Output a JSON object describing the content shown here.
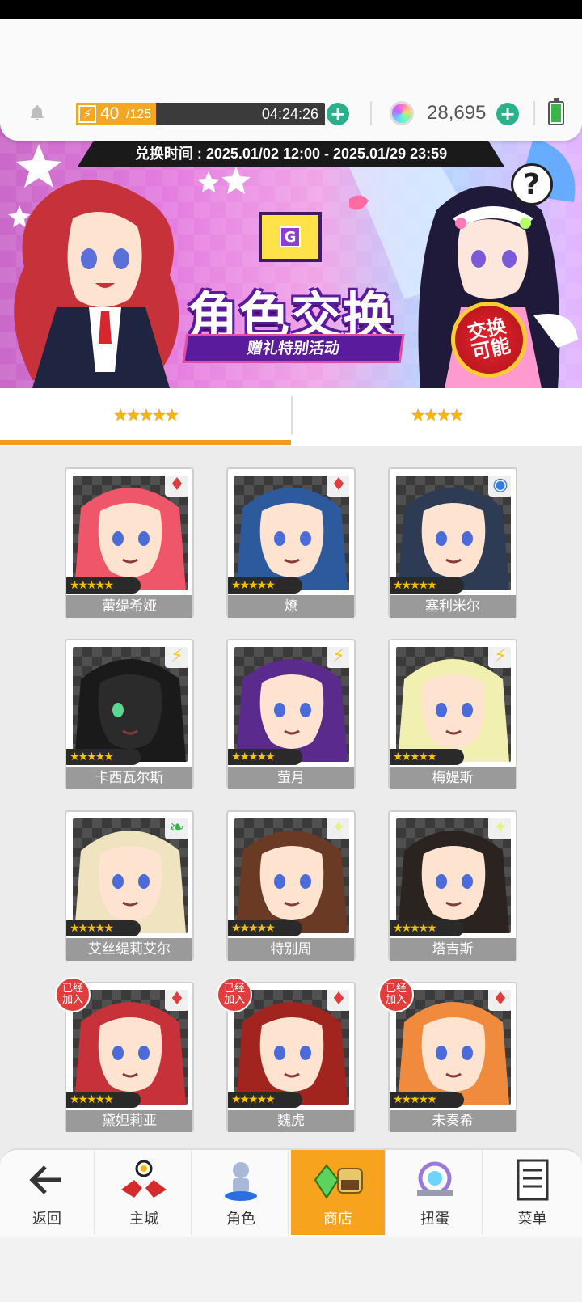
{
  "status_bar": {
    "stamina_current": "40",
    "stamina_max": "/125",
    "stamina_fraction": 0.32,
    "stamina_timer": "04:24:26",
    "gems": "28,695"
  },
  "banner": {
    "date_range": "兑换时间 : 2025.01/02 12:00 - 2025.01/29 23:59",
    "title": "角色交换",
    "subtitle": "赠礼特别活动",
    "badge_line1": "交换",
    "badge_line2": "可能",
    "help": "?",
    "envelope_letter": "G"
  },
  "tabs": [
    {
      "stars": "★★★★★",
      "selected": true
    },
    {
      "stars": "★★★★",
      "selected": false
    }
  ],
  "characters": [
    {
      "name": "蕾缇希娅",
      "stars": "★★★★★",
      "attr": "fire",
      "joined": false
    },
    {
      "name": "燎",
      "stars": "★★★★★",
      "attr": "fire",
      "joined": false
    },
    {
      "name": "塞利米尔",
      "stars": "★★★★★",
      "attr": "water",
      "joined": false
    },
    {
      "name": "卡西瓦尔斯",
      "stars": "★★★★★",
      "attr": "thunder",
      "joined": false
    },
    {
      "name": "萤月",
      "stars": "★★★★★",
      "attr": "thunder",
      "joined": false
    },
    {
      "name": "梅媞斯",
      "stars": "★★★★★",
      "attr": "thunder",
      "joined": false
    },
    {
      "name": "艾丝缇莉艾尔",
      "stars": "★★★★★",
      "attr": "wind",
      "joined": false
    },
    {
      "name": "特别周",
      "stars": "★★★★★",
      "attr": "light",
      "joined": false
    },
    {
      "name": "塔吉斯",
      "stars": "★★★★★",
      "attr": "light",
      "joined": false
    },
    {
      "name": "黛妲莉亚",
      "stars": "★★★★★",
      "attr": "fire",
      "joined": true
    },
    {
      "name": "魏虎",
      "stars": "★★★★★",
      "attr": "fire",
      "joined": true
    },
    {
      "name": "未奏希",
      "stars": "★★★★★",
      "attr": "fire",
      "joined": true
    }
  ],
  "joined_label_1": "已经",
  "joined_label_2": "加入",
  "nav": [
    {
      "label": "返回",
      "icon": "back-arrow-icon",
      "active": false
    },
    {
      "label": "主城",
      "icon": "castle-icon",
      "active": false
    },
    {
      "label": "角色",
      "icon": "character-icon",
      "active": false
    },
    {
      "label": "商店",
      "icon": "shop-icon",
      "active": true
    },
    {
      "label": "扭蛋",
      "icon": "gacha-icon",
      "active": false
    },
    {
      "label": "菜单",
      "icon": "menu-icon",
      "active": false
    }
  ],
  "colors": {
    "accent": "#f19a1b",
    "stamina": "#f5a623",
    "plus": "#2ab08a",
    "fire": "#e23d3d",
    "water": "#2f7de1",
    "thunder": "#f5c518",
    "wind": "#34b34a",
    "light": "#e8f08a"
  }
}
